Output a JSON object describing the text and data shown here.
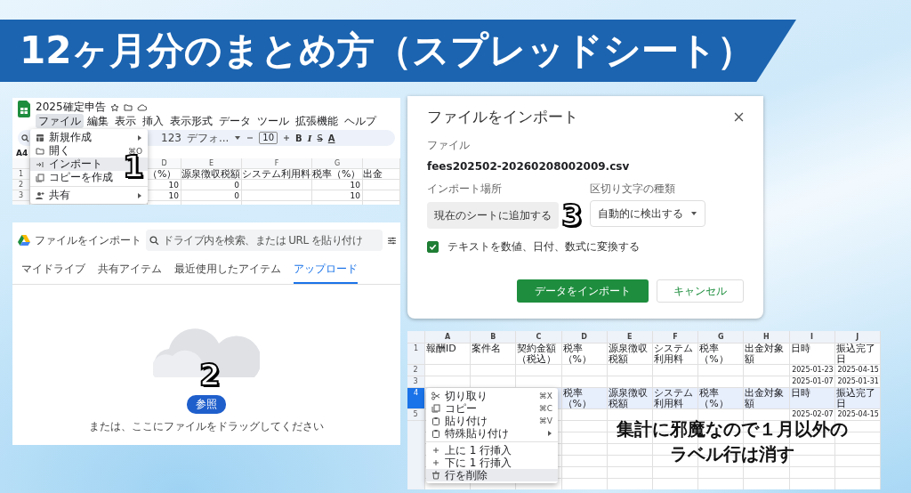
{
  "title": "12ヶ月分のまとめ方（スプレッドシート）",
  "menu_panel": {
    "doc_title": "2025確定申告",
    "menu_bar": [
      {
        "label": "ファイル",
        "selected": true
      },
      {
        "label": "編集",
        "selected": false
      },
      {
        "label": "表示",
        "selected": false
      },
      {
        "label": "挿入",
        "selected": false
      },
      {
        "label": "表示形式",
        "selected": false
      },
      {
        "label": "データ",
        "selected": false
      },
      {
        "label": "ツール",
        "selected": false
      },
      {
        "label": "拡張機能",
        "selected": false
      },
      {
        "label": "ヘルプ",
        "selected": false
      }
    ],
    "toolbar": {
      "number_format": "123",
      "font": "デフォ...",
      "font_size": "10",
      "format_buttons": [
        "B",
        "I",
        "S",
        "A"
      ]
    },
    "name_box": "A4",
    "columns": [
      "D",
      "E",
      "F",
      "G"
    ],
    "rows": [
      {
        "number": "1",
        "cells": [
          "（%）",
          "源泉徴収税額",
          "システム利用料",
          "税率（%）",
          "出金"
        ]
      },
      {
        "number": "2",
        "cells": [
          "10",
          "0",
          null,
          "10",
          null
        ]
      },
      {
        "number": "3",
        "cells": [
          "10",
          "0",
          null,
          "10",
          null
        ]
      }
    ],
    "file_menu": [
      {
        "kind": "submenu",
        "label": "新規作成",
        "selected": false
      },
      {
        "kind": "item",
        "label": "開く",
        "shortcut": "⌘O",
        "selected": false
      },
      {
        "kind": "item",
        "label": "インポート",
        "selected": true
      },
      {
        "kind": "item",
        "label": "コピーを作成",
        "selected": false
      },
      {
        "kind": "divider"
      },
      {
        "kind": "submenu",
        "label": "共有",
        "selected": false
      }
    ],
    "step": "1"
  },
  "picker_panel": {
    "title": "ファイルをインポート",
    "search": {
      "placeholder": "ドライブ内を検索、または URL を貼り付け"
    },
    "tabs": [
      {
        "label": "マイドライブ",
        "selected": false
      },
      {
        "label": "共有アイテム",
        "selected": false
      },
      {
        "label": "最近使用したアイテム",
        "selected": false
      },
      {
        "label": "アップロード",
        "selected": true
      }
    ],
    "browse_button": "参照",
    "hint": "または、ここにファイルをドラッグしてください",
    "step": "2"
  },
  "import_dialog": {
    "title": "ファイルをインポート",
    "file_label": "ファイル",
    "file_name": "fees202502-20260208002009.csv",
    "location_label": "インポート場所",
    "location_value": "現在のシートに追加する",
    "separator_label": "区切り文字の種類",
    "separator_value": "自動的に検出する",
    "convert": {
      "label": "テキストを数値、日付、数式に変換する",
      "checked": true
    },
    "buttons": [
      {
        "kind": "primary",
        "label": "データをインポート"
      },
      {
        "kind": "secondary",
        "label": "キャンセル"
      }
    ],
    "step": "3"
  },
  "sheet_panel": {
    "columns": [
      "A",
      "B",
      "C",
      "D",
      "E",
      "F",
      "G",
      "H",
      "I",
      "J"
    ],
    "rows": [
      {
        "number": "1",
        "kind": "header",
        "selected": false,
        "cells": [
          "報酬ID",
          "案件名",
          "契約金額（税込）",
          "税率（%）",
          "源泉徴収税額",
          "システム利用料",
          "税率（%）",
          "出金対象額",
          "日時",
          "振込完了日"
        ]
      },
      {
        "number": "2",
        "kind": "data",
        "selected": false,
        "cells": [
          null,
          null,
          null,
          null,
          null,
          null,
          null,
          null,
          "2025-01-23",
          "2025-04-15"
        ]
      },
      {
        "number": "3",
        "kind": "data",
        "selected": false,
        "cells": [
          null,
          null,
          null,
          null,
          null,
          null,
          null,
          null,
          "2025-01-07",
          "2025-01-31"
        ]
      },
      {
        "number": "4",
        "kind": "header",
        "selected": true,
        "cells": [
          null,
          null,
          null,
          "税率（%）",
          "源泉徴収税額",
          "システム利用料",
          "税率（%）",
          "出金対象額",
          "日時",
          "振込完了日"
        ]
      },
      {
        "number": "5",
        "kind": "data",
        "selected": false,
        "cells": [
          null,
          null,
          null,
          null,
          null,
          null,
          null,
          null,
          "2025-02-07",
          "2025-04-15"
        ]
      }
    ],
    "context_menu": [
      {
        "kind": "item",
        "label": "切り取り",
        "shortcut": "⌘X",
        "selected": false
      },
      {
        "kind": "item",
        "label": "コピー",
        "shortcut": "⌘C",
        "selected": false
      },
      {
        "kind": "item",
        "label": "貼り付け",
        "shortcut": "⌘V",
        "selected": false
      },
      {
        "kind": "submenu",
        "label": "特殊貼り付け",
        "selected": false
      },
      {
        "kind": "divider"
      },
      {
        "kind": "item",
        "label": "上に 1 行挿入",
        "selected": false
      },
      {
        "kind": "item",
        "label": "下に 1 行挿入",
        "selected": false
      },
      {
        "kind": "item",
        "label": "行を削除",
        "selected": true
      }
    ],
    "note": [
      "集計に邪魔なので１月以外の",
      "ラベル行は消す"
    ]
  }
}
